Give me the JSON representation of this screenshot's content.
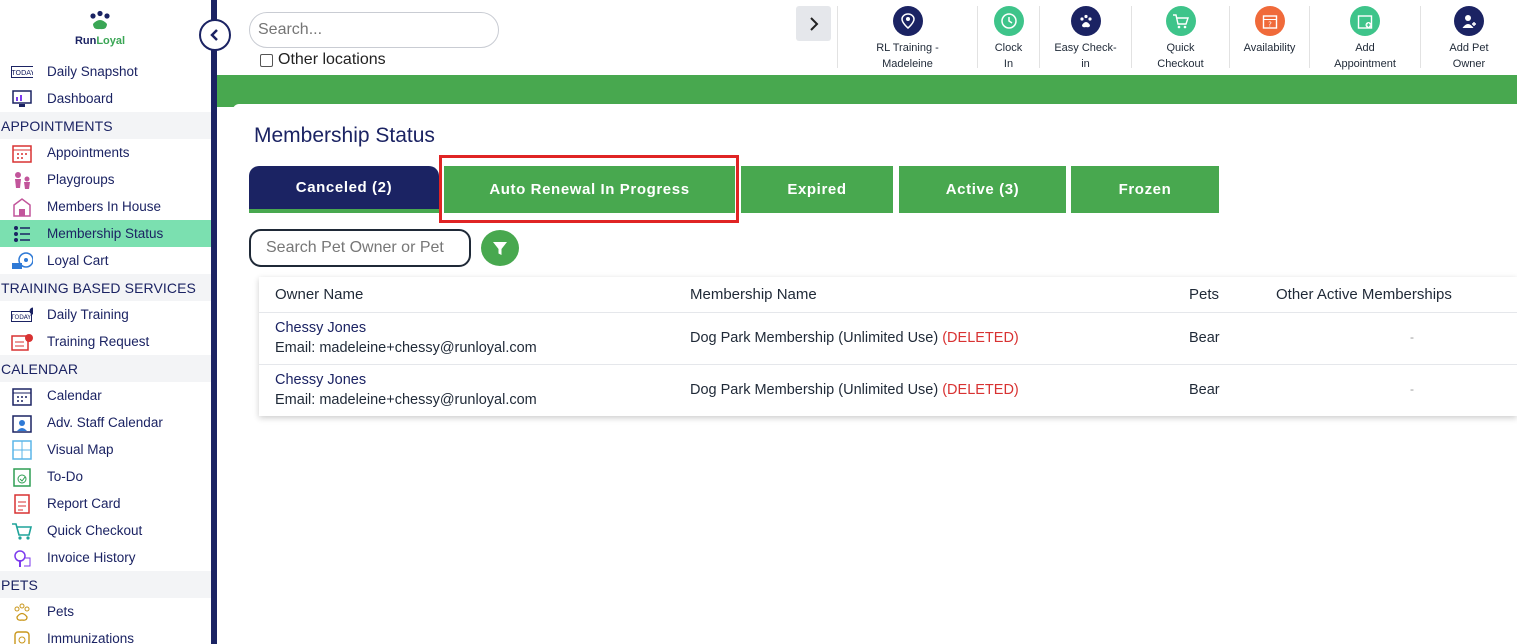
{
  "brand": {
    "logo_text_run": "Run",
    "logo_text_loyal": "Loyal",
    "green": "#48a84f",
    "navy": "#1b2363",
    "highlight": "#e02424"
  },
  "sidebar": {
    "items": [
      {
        "label": "Daily Snapshot",
        "icon": "today-calendar-icon"
      },
      {
        "label": "Dashboard",
        "icon": "dashboard-monitor-icon"
      },
      {
        "section": "APPOINTMENTS"
      },
      {
        "label": "Appointments",
        "icon": "appointments-calendar-icon"
      },
      {
        "label": "Playgroups",
        "icon": "playgroups-dogs-icon"
      },
      {
        "label": "Members In House",
        "icon": "members-house-icon"
      },
      {
        "label": "Membership Status",
        "icon": "membership-list-icon",
        "active": true
      },
      {
        "label": "Loyal Cart",
        "icon": "loyal-cart-icon"
      },
      {
        "section": "TRAINING BASED SERVICES"
      },
      {
        "label": "Daily Training",
        "icon": "today-whistle-icon"
      },
      {
        "label": "Training Request",
        "icon": "training-request-icon"
      },
      {
        "section": "CALENDAR"
      },
      {
        "label": "Calendar",
        "icon": "calendar-icon"
      },
      {
        "label": "Adv. Staff Calendar",
        "icon": "staff-calendar-icon"
      },
      {
        "label": "Visual Map",
        "icon": "visual-map-icon"
      },
      {
        "label": "To-Do",
        "icon": "todo-check-icon"
      },
      {
        "label": "Report Card",
        "icon": "report-card-icon"
      },
      {
        "label": "Quick Checkout",
        "icon": "checkout-cart-icon"
      },
      {
        "label": "Invoice History",
        "icon": "invoice-history-icon"
      },
      {
        "section": "PETS"
      },
      {
        "label": "Pets",
        "icon": "paw-icon"
      },
      {
        "label": "Immunizations",
        "icon": "immunizations-icon"
      }
    ]
  },
  "topbar": {
    "search_placeholder": "Search...",
    "other_locations": "Other locations",
    "actions": [
      {
        "label": "RL Training -\nMadeleine",
        "icon": "location-pin-icon",
        "color": "#1b2363"
      },
      {
        "label": "Clock\nIn",
        "icon": "clock-icon",
        "color": "#3ec48a"
      },
      {
        "label": "Easy Check-\nin",
        "icon": "paw-checkin-icon",
        "color": "#1b2363"
      },
      {
        "label": "Quick\nCheckout",
        "icon": "quick-checkout-icon",
        "color": "#3ec48a"
      },
      {
        "label": "Availability",
        "icon": "availability-calendar-icon",
        "color": "#f06a3a"
      },
      {
        "label": "Add\nAppointment",
        "icon": "add-appointment-icon",
        "color": "#3ec48a"
      },
      {
        "label": "Add Pet\nOwner",
        "icon": "add-owner-icon",
        "color": "#1b2363"
      }
    ]
  },
  "main": {
    "title": "Membership Status",
    "tabs": [
      "Canceled (2)",
      "Auto Renewal In Progress",
      "Expired",
      "Active (3)",
      "Frozen"
    ],
    "search_placeholder": "Search Pet Owner or Pet",
    "table": {
      "headers": [
        "Owner Name",
        "Membership Name",
        "Pets",
        "Other Active Memberships"
      ],
      "rows": [
        {
          "owner": "Chessy Jones",
          "email": "Email: madeleine+chessy@runloyal.com",
          "membership": "Dog Park Membership (Unlimited Use)",
          "status": "(DELETED)",
          "pets": "Bear",
          "other": "-"
        },
        {
          "owner": "Chessy Jones",
          "email": "Email: madeleine+chessy@runloyal.com",
          "membership": "Dog Park Membership (Unlimited Use)",
          "status": "(DELETED)",
          "pets": "Bear",
          "other": "-"
        }
      ]
    }
  }
}
